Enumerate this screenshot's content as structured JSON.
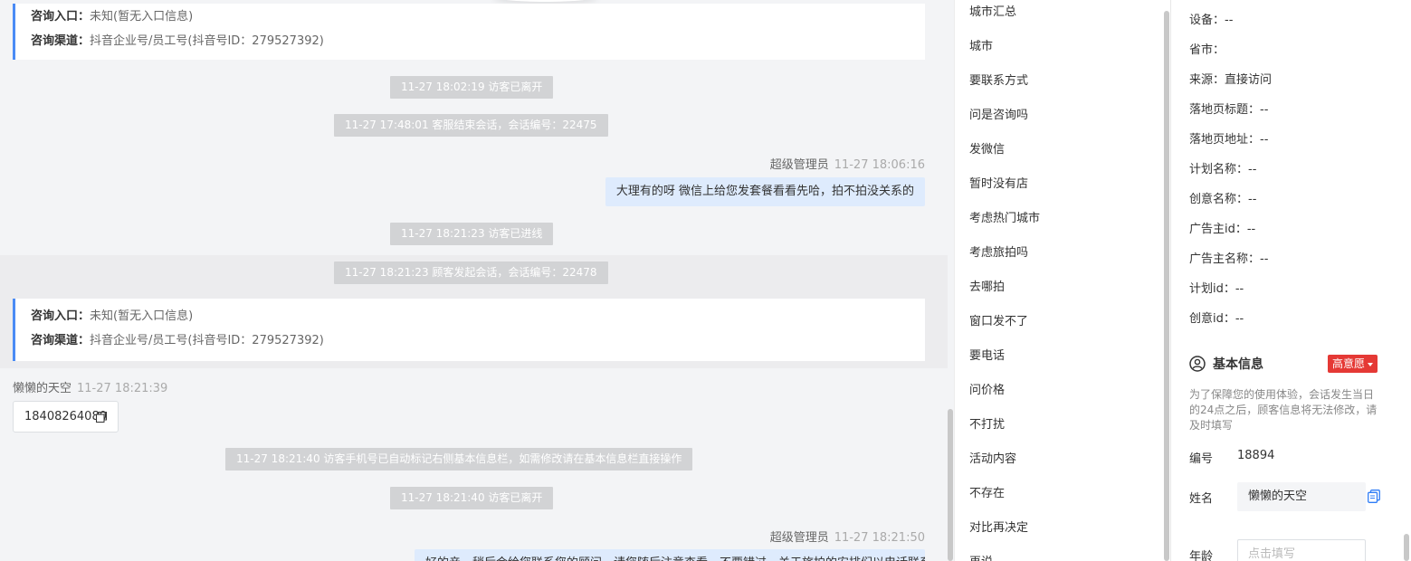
{
  "chat": {
    "card1": {
      "entry_label": "咨询入口：",
      "entry_value": "未知(暂无入口信息)",
      "channel_label": "咨询渠道：",
      "channel_value": "抖音企业号/员工号(抖音号ID：279527392)"
    },
    "sys1": "11-27 18:02:19 访客已离开",
    "sys2": "11-27 17:48:01 客服结束会话，会话编号：22475",
    "msg1": {
      "sender": "超级管理员",
      "time": "11-27 18:06:16",
      "text": "大理有的呀 微信上给您发套餐看看先哈，拍不拍没关系的"
    },
    "sys3": "11-27 18:21:23 访客已进线",
    "sys4": "11-27 18:21:23 顾客发起会话，会话编号：22478",
    "card2": {
      "entry_label": "咨询入口：",
      "entry_value": "未知(暂无入口信息)",
      "channel_label": "咨询渠道：",
      "channel_value": "抖音企业号/员工号(抖音号ID：279527392)"
    },
    "msg2": {
      "sender": "懒懒的天空",
      "time": "11-27 18:21:39",
      "text": "18408264080"
    },
    "sys5": "11-27 18:21:40 访客手机号已自动标记右侧基本信息栏，如需修改请在基本信息栏直接操作",
    "sys6": "11-27 18:21:40 访客已离开",
    "msg3": {
      "sender": "超级管理员",
      "time": "11-27 18:21:50",
      "text": "好的亲，稍后会给您联系您的顾问，请您随后注意查看，不要错过，关于旅拍的安排们以电话联系"
    }
  },
  "quick_replies": [
    "城市汇总",
    "城市",
    "要联系方式",
    "问是咨询吗",
    "发微信",
    "暂时没有店",
    "考虑热门城市",
    "考虑旅拍吗",
    "去哪拍",
    "窗口发不了",
    "要电话",
    "问价格",
    "不打扰",
    "活动内容",
    "不存在",
    "对比再决定",
    "再说"
  ],
  "visitor": {
    "device": "设备：--",
    "province": "省市：",
    "source": "来源：直接访问",
    "landing_title": "落地页标题：--",
    "landing_url": "落地页地址：--",
    "plan_name": "计划名称：--",
    "creative_name": "创意名称：--",
    "advertiser_id": "广告主id：--",
    "advertiser_name": "广告主名称：--",
    "plan_id": "计划id：--",
    "creative_id": "创意id：--"
  },
  "basic": {
    "title": "基本信息",
    "intent_badge": "高意愿",
    "notice": "为了保障您的使用体验，会话发生当日的24点之后，顾客信息将无法修改，请及时填写",
    "id_label": "编号",
    "id_value": "18894",
    "name_label": "姓名",
    "name_value": "懒懒的天空",
    "age_label": "年龄",
    "age_placeholder": "点击填写"
  },
  "colors": {
    "accent": "#4a8bf5",
    "badge": "#e53935",
    "bubble": "#deebfd"
  }
}
